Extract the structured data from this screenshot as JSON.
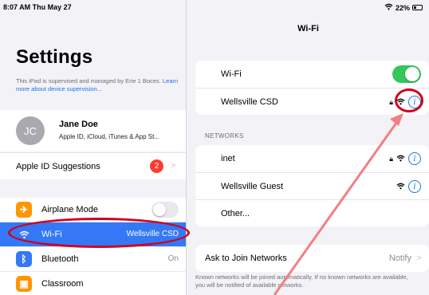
{
  "status_bar": {
    "time_date": "8:07 AM  Thu May 27",
    "battery": "22%"
  },
  "sidebar": {
    "title": "Settings",
    "supervised_text": "This iPad is supervised and managed by Erie 1 Boces.",
    "supervised_link": "Learn more about device supervision...",
    "profile": {
      "initials": "JC",
      "name": "Jane Doe",
      "subtitle": "Apple ID, iCloud, iTunes & App St..."
    },
    "apple_id_suggestions": {
      "label": "Apple ID Suggestions",
      "badge": "2"
    },
    "items": [
      {
        "label": "Airplane Mode",
        "icon": "airplane-icon",
        "color": "#ff9500"
      },
      {
        "label": "Wi-Fi",
        "value": "Wellsville CSD",
        "icon": "wifi-icon",
        "color": "#3478f6"
      },
      {
        "label": "Bluetooth",
        "value": "On",
        "icon": "bluetooth-icon",
        "color": "#3478f6"
      },
      {
        "label": "Classroom",
        "icon": "classroom-icon",
        "color": "#ff9500"
      }
    ]
  },
  "detail": {
    "title": "Wi-Fi",
    "wifi_label": "Wi-Fi",
    "connected_network": "Wellsville CSD",
    "networks_header": "NETWORKS",
    "networks": [
      {
        "name": "inet",
        "locked": true
      },
      {
        "name": "Wellsville Guest",
        "locked": false
      }
    ],
    "other_label": "Other...",
    "ask_to_join": {
      "label": "Ask to Join Networks",
      "value": "Notify"
    },
    "footnote": "Known networks will be joined automatically. If no known networks are available, you will be notified of available networks."
  },
  "annotation_colors": {
    "highlight": "#d0021b",
    "arrow": "#f08080"
  }
}
